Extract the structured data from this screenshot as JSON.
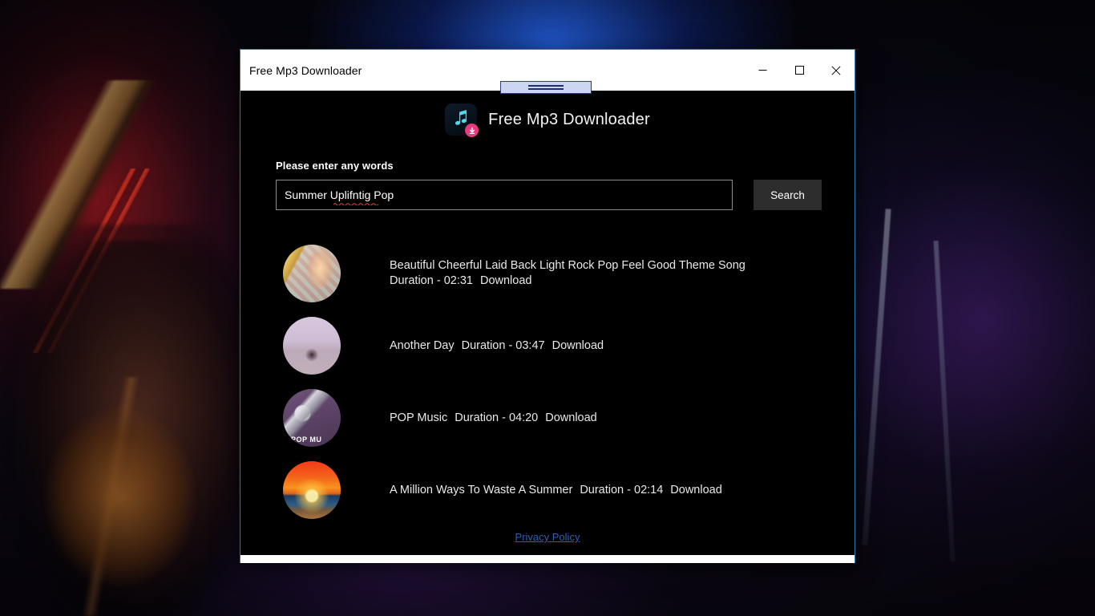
{
  "window": {
    "title": "Free Mp3 Downloader",
    "controls": {
      "minimize": "minimize-button",
      "maximize": "maximize-button",
      "close": "close-button"
    },
    "accent_border": "#2a7ba8"
  },
  "brand": {
    "title": "Free Mp3 Downloader",
    "icon_name": "music-note-download-icon",
    "icon_note_color": "#4fd8ef",
    "icon_badge_color": "#e8387f"
  },
  "search": {
    "label": "Please enter any words",
    "value": "Summer Uplifntig Pop",
    "placeholder": "",
    "misspelled_word": "Uplifntig",
    "button_label": "Search",
    "button_color": "#2d2d2d"
  },
  "results": [
    {
      "title": "Beautiful Cheerful Laid Back Light Rock Pop Feel Good Theme Song",
      "duration_label": "Duration - 02:31",
      "download_label": "Download",
      "thumb_name": "thumbnail-girl-with-guitar"
    },
    {
      "title": "Another Day",
      "duration_label": "Duration - 03:47",
      "download_label": "Download",
      "thumb_name": "thumbnail-misty-beach"
    },
    {
      "title": "POP Music",
      "duration_label": "Duration - 04:20",
      "download_label": "Download",
      "thumb_name": "thumbnail-microphone"
    },
    {
      "title": "A Million Ways To Waste A Summer",
      "duration_label": "Duration - 02:14",
      "download_label": "Download",
      "thumb_name": "thumbnail-sunset-palms"
    }
  ],
  "footer": {
    "privacy_label": "Privacy Policy",
    "privacy_color": "#2b5fb8"
  }
}
